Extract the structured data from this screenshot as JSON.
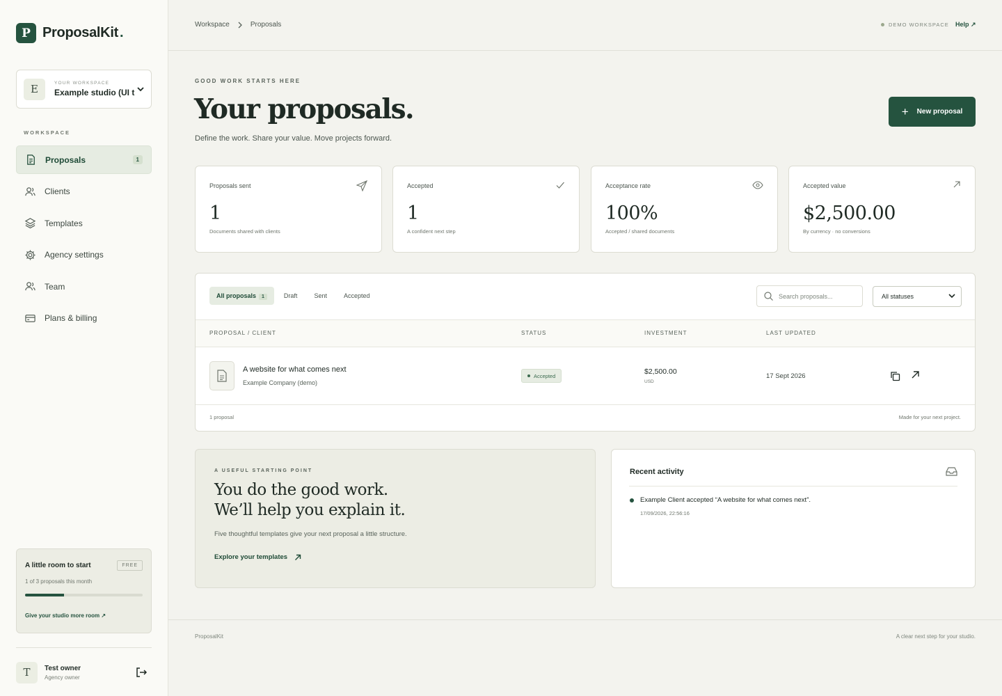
{
  "brand": {
    "mark": "P",
    "name": "ProposalKit",
    "dot": "."
  },
  "workspace": {
    "initial": "E",
    "eyebrow": "YOUR WORKSPACE",
    "name": "Example studio (UI test)"
  },
  "sidebar": {
    "section": "WORKSPACE",
    "items": [
      {
        "label": "Proposals",
        "icon": "document-icon",
        "count": "1"
      },
      {
        "label": "Clients",
        "icon": "users-icon"
      },
      {
        "label": "Templates",
        "icon": "layers-icon"
      },
      {
        "label": "Agency settings",
        "icon": "gear-icon"
      },
      {
        "label": "Team",
        "icon": "users-icon"
      },
      {
        "label": "Plans & billing",
        "icon": "credit-card-icon"
      }
    ]
  },
  "plan": {
    "title": "A little room to start",
    "badge": "FREE",
    "usage": "1 of 3 proposals this month",
    "progress": 0.333,
    "link": "Give your studio more room ↗"
  },
  "user": {
    "initial": "T",
    "name": "Test owner",
    "role": "Agency owner"
  },
  "topbar": {
    "breadcrumb": [
      "Workspace",
      "Proposals"
    ],
    "demo": "DEMO WORKSPACE",
    "help": "Help ↗"
  },
  "hero": {
    "eyebrow": "GOOD WORK STARTS HERE",
    "title": "Your proposals.",
    "subtitle": "Define the work. Share your value. Move projects forward.",
    "new_button": "New proposal"
  },
  "stats": [
    {
      "label": "Proposals sent",
      "value": "1",
      "sub": "Documents shared with clients",
      "icon": "send-icon"
    },
    {
      "label": "Accepted",
      "value": "1",
      "sub": "A confident next step",
      "icon": "check-icon"
    },
    {
      "label": "Acceptance rate",
      "value": "100%",
      "sub": "Accepted / shared documents",
      "icon": "eye-icon"
    },
    {
      "label": "Accepted value",
      "value": "$2,500.00",
      "sub": "By currency · no conversions",
      "icon": "arrow-up-right-icon"
    }
  ],
  "table": {
    "tabs": [
      {
        "label": "All proposals",
        "count": "1"
      },
      {
        "label": "Draft"
      },
      {
        "label": "Sent"
      },
      {
        "label": "Accepted"
      }
    ],
    "search_placeholder": "Search proposals...",
    "status_filter": "All statuses",
    "columns": [
      "PROPOSAL / CLIENT",
      "STATUS",
      "INVESTMENT",
      "LAST UPDATED"
    ],
    "rows": [
      {
        "title": "A website for what comes next",
        "client": "Example Company (demo)",
        "status": "Accepted",
        "amount": "$2,500.00",
        "currency": "USD",
        "updated": "17 Sept 2026"
      }
    ],
    "footer_count": "1 proposal",
    "footer_note": "Made for your next project."
  },
  "promo": {
    "eyebrow": "A USEFUL STARTING POINT",
    "title_line1": "You do the good work.",
    "title_line2": "We’ll help you explain it.",
    "subtitle": "Five thoughtful templates give your next proposal a little structure.",
    "link": "Explore your templates"
  },
  "activity": {
    "title": "Recent activity",
    "items": [
      {
        "text": "Example Client accepted “A website for what comes next”.",
        "time": "17/09/2026, 22:56:16"
      }
    ]
  },
  "footer": {
    "left": "ProposalKit",
    "right": "A clear next step for your studio."
  },
  "colors": {
    "accent": "#25533f",
    "background": "#f3f3ee",
    "sidebar": "#fafaf6",
    "success_bg": "#e6ece2"
  }
}
